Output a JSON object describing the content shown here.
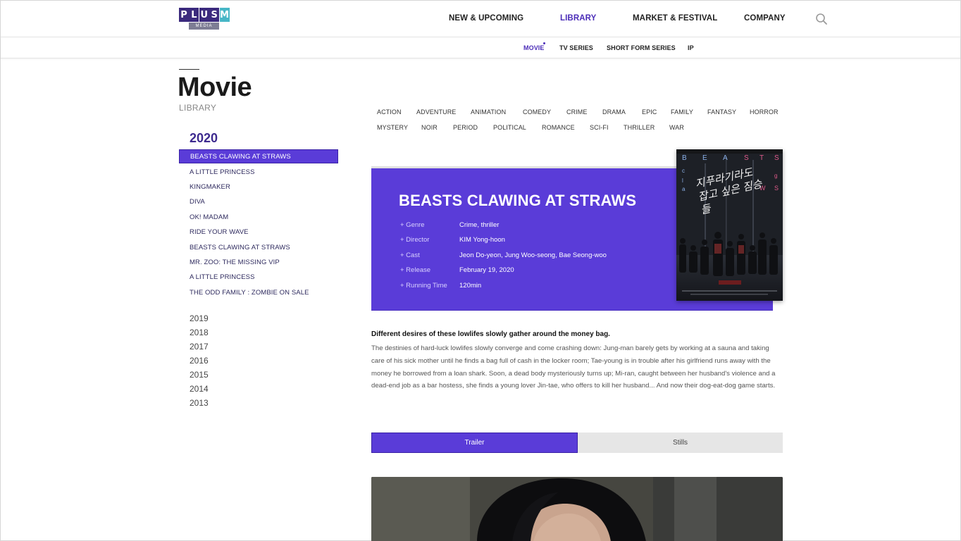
{
  "brand": {
    "logo_letters": [
      "P",
      "L",
      "U",
      "S",
      "M"
    ],
    "logo_colors": [
      "#3b2a7d",
      "#3b2a7d",
      "#3b2a7d",
      "#3b2a7d",
      "#47b6c6"
    ],
    "logo_sub": "MEDIA"
  },
  "nav": {
    "items": [
      {
        "label": "NEW & UPCOMING"
      },
      {
        "label": "LIBRARY"
      },
      {
        "label": "MARKET & FESTIVAL"
      },
      {
        "label": "COMPANY"
      }
    ],
    "active": "LIBRARY",
    "search_icon": "search-icon"
  },
  "subnav": {
    "items": [
      {
        "label": "MOVIE"
      },
      {
        "label": "TV SERIES"
      },
      {
        "label": "SHORT FORM SERIES"
      },
      {
        "label": "IP"
      }
    ],
    "active": "MOVIE"
  },
  "page": {
    "title": "Movie",
    "subtitle": "LIBRARY"
  },
  "sidebar": {
    "current_year": "2020",
    "movies": [
      "BEASTS CLAWING AT STRAWS",
      "A LITTLE PRINCESS",
      "KINGMAKER",
      "DIVA",
      "OK! MADAM",
      "RIDE YOUR WAVE",
      "BEASTS CLAWING AT STRAWS",
      "MR. ZOO: THE MISSING VIP",
      "A LITTLE PRINCESS",
      "THE ODD FAMILY : ZOMBIE ON SALE"
    ],
    "active_index": 0,
    "years": [
      "2019",
      "2018",
      "2017",
      "2016",
      "2015",
      "2014",
      "2013"
    ]
  },
  "genres": {
    "row1": [
      "ACTION",
      "ADVENTURE",
      "ANIMATION",
      "COMEDY",
      "CRIME",
      "DRAMA",
      "EPIC",
      "FAMILY",
      "FANTASY",
      "HORROR"
    ],
    "row2": [
      "MYSTERY",
      "NOIR",
      "PERIOD",
      "POLITICAL",
      "ROMANCE",
      "SCI-FI",
      "THRILLER",
      "WAR"
    ]
  },
  "movie": {
    "title": "BEASTS CLAWING AT STRAWS",
    "info": [
      {
        "label": "+ Genre",
        "value": "Crime, thriller"
      },
      {
        "label": "+ Director",
        "value": "KIM Yong-hoon"
      },
      {
        "label": "+ Cast",
        "value": "Jeon Do-yeon, Jung Woo-seong, Bae Seong-woo"
      },
      {
        "label": "+ Release",
        "value": "February 19, 2020"
      },
      {
        "label": "+ Running Time",
        "value": "120min"
      }
    ],
    "poster": {
      "letters_top": [
        "B",
        "E",
        "A",
        "S",
        "T",
        "S"
      ],
      "letters_left": [
        "c",
        "l",
        "a"
      ],
      "letters_right": [
        "g",
        "W",
        "S"
      ],
      "korean_title": "지푸라기라도 잡고 싶은 짐승들"
    },
    "synopsis_head": "Different desires of these lowlifes slowly gather around the money bag.",
    "synopsis_body": "The destinies of hard-luck lowlifes slowly converge and come crashing down: Jung-man barely gets by working at a sauna and taking care of his sick mother until he finds a bag full of cash in the locker room; Tae-young is in trouble after his girlfriend runs away with the money he borrowed from a loan shark. Soon, a dead body mysteriously turns up; Mi-ran, caught between her husband's violence and a dead-end job as a bar hostess, she finds a young lover Jin-tae, who offers to kill her husband... And now their dog-eat-dog game starts."
  },
  "tabs": [
    {
      "label": "Trailer"
    },
    {
      "label": "Stills"
    }
  ],
  "colors": {
    "accent": "#5a3cd8",
    "accent_dark": "#3d2a8f",
    "tab_inactive": "#e6e6e6"
  }
}
